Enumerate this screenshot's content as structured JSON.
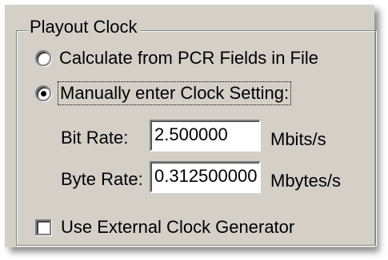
{
  "group": {
    "title": "Playout Clock"
  },
  "clock_mode": {
    "options": [
      {
        "label": "Calculate from PCR Fields in File",
        "selected": false
      },
      {
        "label": "Manually enter Clock Setting:",
        "selected": true
      }
    ]
  },
  "fields": {
    "bit_rate": {
      "label": "Bit Rate:",
      "value": "2.500000",
      "unit": "Mbits/s"
    },
    "byte_rate": {
      "label": "Byte Rate:",
      "value": "0.312500000",
      "unit": "Mbytes/s"
    }
  },
  "external_clock": {
    "label": "Use External Clock Generator",
    "checked": false
  }
}
